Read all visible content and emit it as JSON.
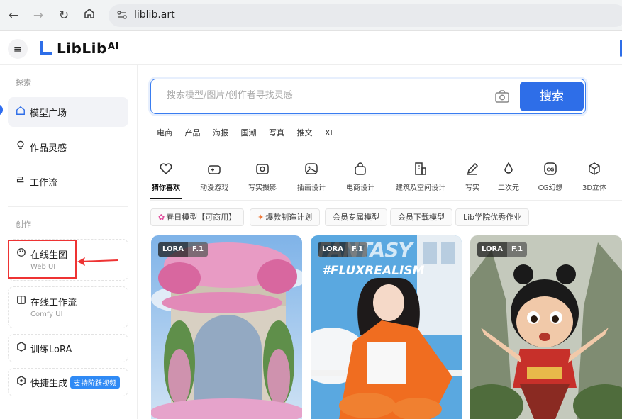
{
  "browser": {
    "url": "liblib.art"
  },
  "header": {
    "logo_text": "LibLib",
    "logo_suffix": "AI"
  },
  "sidebar": {
    "section_explore": "探索",
    "section_create": "创作",
    "items": [
      {
        "label": "模型广场",
        "icon": "home-icon"
      },
      {
        "label": "作品灵感",
        "icon": "bulb-icon"
      },
      {
        "label": "工作流",
        "icon": "workflow-icon"
      }
    ],
    "cards": [
      {
        "label": "在线生图",
        "sub": "Web UI",
        "icon": "palette-icon"
      },
      {
        "label": "在线工作流",
        "sub": "Comfy UI",
        "icon": "grid-icon"
      },
      {
        "label": "训练LoRA",
        "icon": "cube-icon"
      },
      {
        "label": "快捷生成",
        "badge": "支持阶跃视频",
        "icon": "sparkle-icon"
      }
    ]
  },
  "search": {
    "placeholder": "搜索模型/图片/创作者寻找灵感",
    "button_label": "搜索"
  },
  "hot_tags": [
    "电商",
    "产品",
    "海报",
    "国潮",
    "写真",
    "推文",
    "XL"
  ],
  "categories": [
    {
      "label": "猜你喜欢",
      "icon": "heart-icon",
      "active": true
    },
    {
      "label": "动漫游戏",
      "icon": "gamepad-icon"
    },
    {
      "label": "写实摄影",
      "icon": "camera-icon"
    },
    {
      "label": "插画设计",
      "icon": "image-icon"
    },
    {
      "label": "电商设计",
      "icon": "bag-icon"
    },
    {
      "label": "建筑及空间设计",
      "icon": "building-icon"
    },
    {
      "label": "写实",
      "icon": "pen-icon"
    },
    {
      "label": "二次元",
      "icon": "drop-icon"
    },
    {
      "label": "CG幻想",
      "icon": "cg-icon"
    },
    {
      "label": "3D立体",
      "icon": "box-icon"
    }
  ],
  "chips": [
    {
      "prefix": "✿",
      "label": "春日模型【可商用】"
    },
    {
      "prefix": "✦",
      "label": "爆款制造计划"
    },
    {
      "label": "会员专属模型"
    },
    {
      "label": "会员下载模型"
    },
    {
      "label": "Lib学院优秀作业"
    }
  ],
  "gallery": [
    {
      "tag": "LORA",
      "tag2": "F.1"
    },
    {
      "tag": "LORA",
      "tag2": "F.1",
      "title1": "FANTASY",
      "title2": "#FLUXREALISM"
    },
    {
      "tag": "LORA",
      "tag2": "F.1"
    }
  ],
  "colors": {
    "primary": "#2e6ee8",
    "highlight": "#e33333"
  }
}
